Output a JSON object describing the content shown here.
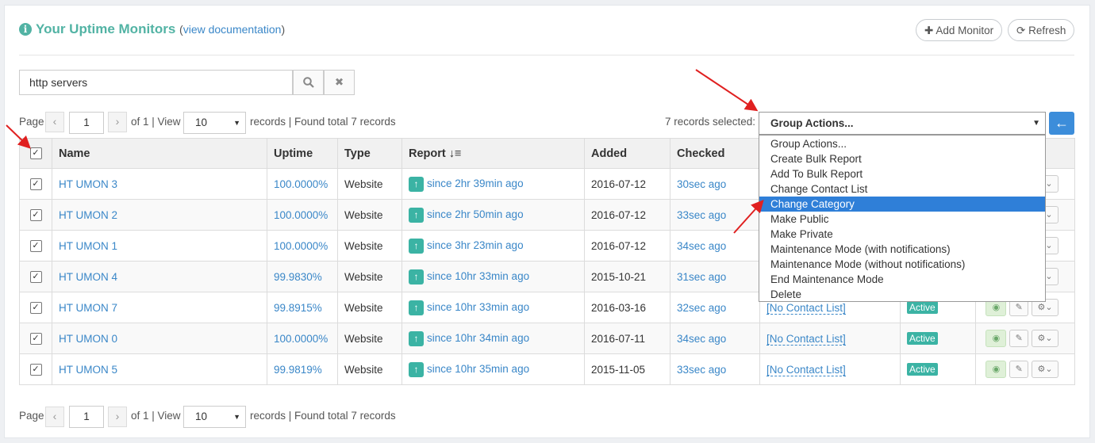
{
  "header": {
    "title": "Your Uptime Monitors",
    "doc_prefix": "(",
    "doc_link": "view documentation",
    "doc_suffix": ")",
    "add_monitor": "Add Monitor",
    "refresh": "Refresh"
  },
  "search": {
    "value": "http servers"
  },
  "pager_top": {
    "page_label": "Page",
    "page_value": "1",
    "of_text": "of 1 | View",
    "view_value": "10",
    "records_text": "records | Found total 7 records"
  },
  "pager_bottom": {
    "page_label": "Page",
    "page_value": "1",
    "of_text": "of 1 | View",
    "view_value": "10",
    "records_text": "records | Found total 7 records"
  },
  "group_actions": {
    "selected_text": "7 records selected:",
    "value": "Group Actions...",
    "options": [
      "Group Actions...",
      "Create Bulk Report",
      "Add To Bulk Report",
      "Change Contact List",
      "Change Category",
      "Make Public",
      "Make Private",
      "Maintenance Mode (with notifications)",
      "Maintenance Mode (without notifications)",
      "End Maintenance Mode",
      "Delete"
    ],
    "highlighted_index": 4
  },
  "table": {
    "columns": [
      "Name",
      "Uptime",
      "Type",
      "Report",
      "Added",
      "Checked"
    ],
    "rows": [
      {
        "name": "HT UMON 3",
        "uptime": "100.0000%",
        "type": "Website",
        "report": "since 2hr 39min ago",
        "added": "2016-07-12",
        "checked": "30sec ago",
        "contact": "",
        "status": ""
      },
      {
        "name": "HT UMON 2",
        "uptime": "100.0000%",
        "type": "Website",
        "report": "since 2hr 50min ago",
        "added": "2016-07-12",
        "checked": "33sec ago",
        "contact": "",
        "status": ""
      },
      {
        "name": "HT UMON 1",
        "uptime": "100.0000%",
        "type": "Website",
        "report": "since 3hr 23min ago",
        "added": "2016-07-12",
        "checked": "34sec ago",
        "contact": "",
        "status": ""
      },
      {
        "name": "HT UMON 4",
        "uptime": "99.9830%",
        "type": "Website",
        "report": "since 10hr 33min ago",
        "added": "2015-10-21",
        "checked": "31sec ago",
        "contact": "",
        "status": ""
      },
      {
        "name": "HT UMON 7",
        "uptime": "99.8915%",
        "type": "Website",
        "report": "since 10hr 33min ago",
        "added": "2016-03-16",
        "checked": "32sec ago",
        "contact": "[No Contact List]",
        "status": "Active"
      },
      {
        "name": "HT UMON 0",
        "uptime": "100.0000%",
        "type": "Website",
        "report": "since 10hr 34min ago",
        "added": "2016-07-11",
        "checked": "34sec ago",
        "contact": "[No Contact List]",
        "status": "Active"
      },
      {
        "name": "HT UMON 5",
        "uptime": "99.9819%",
        "type": "Website",
        "report": "since 10hr 35min ago",
        "added": "2015-11-05",
        "checked": "33sec ago",
        "contact": "[No Contact List]",
        "status": "Active"
      }
    ]
  },
  "icons": {
    "info": "info-circle-icon",
    "plus": "plus-icon",
    "refresh": "refresh-icon",
    "search": "search-icon",
    "clear": "close-icon",
    "sort": "sort-icon",
    "up": "arrow-up-icon",
    "eye": "eye-icon",
    "pencil": "pencil-icon",
    "gear": "gear-icon",
    "go": "arrow-left-icon"
  },
  "colors": {
    "accent": "#52b3a4",
    "link": "#3a87c8",
    "highlight": "#2f7fd8",
    "annotation_arrow": "#e02020"
  }
}
